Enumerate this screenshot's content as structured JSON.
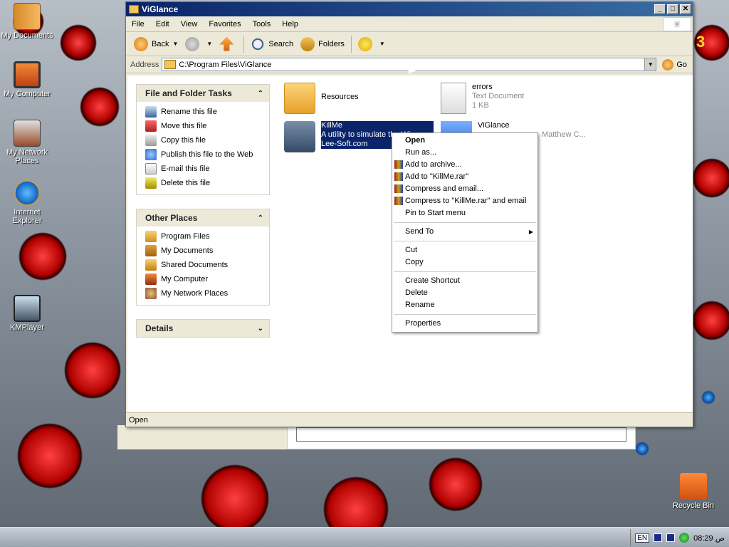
{
  "desktop": {
    "icons": [
      {
        "label": "My Documents"
      },
      {
        "label": "My Computer"
      },
      {
        "label": "My Network Places"
      },
      {
        "label": "Internet Explorer"
      },
      {
        "label": "KMPlayer"
      },
      {
        "label": "Recycle Bin"
      }
    ],
    "corner_digit": "3"
  },
  "window": {
    "title": "ViGlance",
    "controls": {
      "minimize": "_",
      "maximize": "□",
      "close": "✕"
    },
    "menu": [
      "File",
      "Edit",
      "View",
      "Favorites",
      "Tools",
      "Help"
    ],
    "toolbar": {
      "back": "Back",
      "search": "Search",
      "folders": "Folders"
    },
    "address": {
      "label": "Address",
      "value": "C:\\Program Files\\ViGlance",
      "go": "Go"
    },
    "status": "Open"
  },
  "tasks": {
    "file_folder": {
      "title": "File and Folder Tasks",
      "items": [
        "Rename this file",
        "Move this file",
        "Copy this file",
        "Publish this file to the Web",
        "E-mail this file",
        "Delete this file"
      ]
    },
    "other_places": {
      "title": "Other Places",
      "items": [
        "Program Files",
        "My Documents",
        "Shared Documents",
        "My Computer",
        "My Network Places"
      ]
    },
    "details": {
      "title": "Details"
    }
  },
  "files": [
    {
      "name": "Resources",
      "line2": "",
      "line3": ""
    },
    {
      "name": "errors",
      "line2": "Text Document",
      "line3": "1 KB"
    },
    {
      "name": "KillMe",
      "line2": "A utility to simulate the Wi...",
      "line3": "Lee-Soft.com"
    },
    {
      "name": "ViGlance",
      "line2": "Matthew C...",
      "line3": ""
    }
  ],
  "context_menu": {
    "group1": [
      "Open",
      "Run as...",
      "Add to archive...",
      "Add to \"KillMe.rar\"",
      "Compress and email...",
      "Compress to \"KillMe.rar\" and email",
      "Pin to Start menu"
    ],
    "group2": [
      "Send To"
    ],
    "group3": [
      "Cut",
      "Copy"
    ],
    "group4": [
      "Create Shortcut",
      "Delete",
      "Rename"
    ],
    "group5": [
      "Properties"
    ]
  },
  "taskbar": {
    "lang": "EN",
    "clock": "08:29 ص"
  },
  "colors": {
    "selection": "#0a246a",
    "titlebar": "#0a246a"
  }
}
